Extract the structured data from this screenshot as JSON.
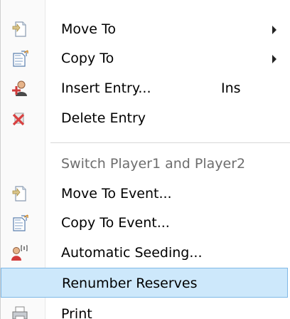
{
  "menu": {
    "items": [
      {
        "label": "Move To",
        "icon": "move-to-icon",
        "has_submenu": true
      },
      {
        "label": "Copy To",
        "icon": "copy-to-icon",
        "has_submenu": true
      },
      {
        "label": "Insert Entry...",
        "shortcut": "Ins",
        "icon": "insert-entry-icon"
      },
      {
        "label": "Delete Entry",
        "icon": "delete-entry-icon"
      },
      {
        "label": "Switch Player1 and Player2",
        "disabled": true
      },
      {
        "label": "Move To Event...",
        "icon": "move-to-event-icon"
      },
      {
        "label": "Copy To Event...",
        "icon": "copy-to-event-icon"
      },
      {
        "label": "Automatic Seeding...",
        "icon": "automatic-seeding-icon"
      },
      {
        "label": "Renumber Reserves",
        "highlighted": true
      },
      {
        "label": "Print",
        "icon": "print-icon"
      }
    ]
  },
  "colors": {
    "highlight_bg": "#cde8fb",
    "highlight_border": "#7fb8e6",
    "disabled_text": "#6d6d6d"
  }
}
